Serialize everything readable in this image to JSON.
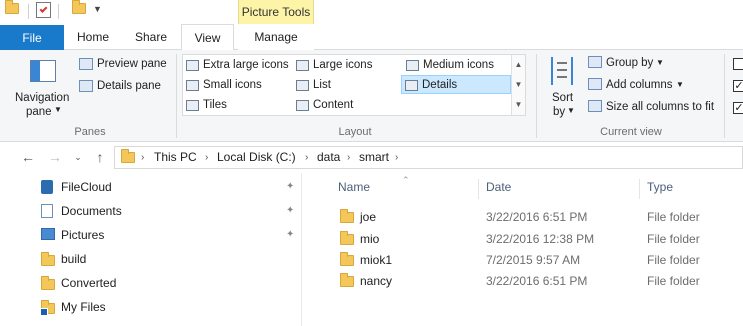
{
  "window": {
    "context_tab_group": "Picture Tools"
  },
  "ribbon_tabs": [
    "File",
    "Home",
    "Share",
    "View",
    "Manage"
  ],
  "ribbon": {
    "panes": {
      "navigation_pane_label_1": "Navigation",
      "navigation_pane_label_2": "pane",
      "preview_pane": "Preview pane",
      "details_pane": "Details pane",
      "group_label": "Panes"
    },
    "layout": {
      "options": [
        {
          "label": "Extra large icons",
          "selected": false
        },
        {
          "label": "Large icons",
          "selected": false
        },
        {
          "label": "Medium icons",
          "selected": false
        },
        {
          "label": "Small icons",
          "selected": false
        },
        {
          "label": "List",
          "selected": false
        },
        {
          "label": "Details",
          "selected": true
        },
        {
          "label": "Tiles",
          "selected": false
        },
        {
          "label": "Content",
          "selected": false
        }
      ],
      "group_label": "Layout"
    },
    "current_view": {
      "sort_by_1": "Sort",
      "sort_by_2": "by",
      "group_by": "Group by",
      "add_columns": "Add columns",
      "size_all_columns": "Size all columns to fit",
      "group_label": "Current view"
    }
  },
  "address_bar": {
    "crumbs": [
      "This PC",
      "Local Disk (C:)",
      "data",
      "smart"
    ]
  },
  "nav_pane": {
    "items": [
      {
        "label": "FileCloud",
        "icon": "filecloud-icon",
        "pinned": true
      },
      {
        "label": "Documents",
        "icon": "documents-icon",
        "pinned": true
      },
      {
        "label": "Pictures",
        "icon": "pictures-icon",
        "pinned": true
      },
      {
        "label": "build",
        "icon": "folder-icon",
        "pinned": false
      },
      {
        "label": "Converted",
        "icon": "folder-icon",
        "pinned": false
      },
      {
        "label": "My Files",
        "icon": "myfiles-icon",
        "pinned": false
      }
    ]
  },
  "file_list": {
    "columns": [
      "Name",
      "Date",
      "Type"
    ],
    "rows": [
      {
        "name": "joe",
        "date": "3/22/2016 6:51 PM",
        "type": "File folder"
      },
      {
        "name": "mio",
        "date": "3/22/2016 12:38 PM",
        "type": "File folder"
      },
      {
        "name": "miok1",
        "date": "7/2/2015 9:57 AM",
        "type": "File folder"
      },
      {
        "name": "nancy",
        "date": "3/22/2016 6:51 PM",
        "type": "File folder"
      }
    ]
  },
  "colors": {
    "file_tab": "#1979ca",
    "context_tab": "#fdf4a8",
    "selected_layout": "#cce8ff",
    "folder": "#f3c75a"
  }
}
